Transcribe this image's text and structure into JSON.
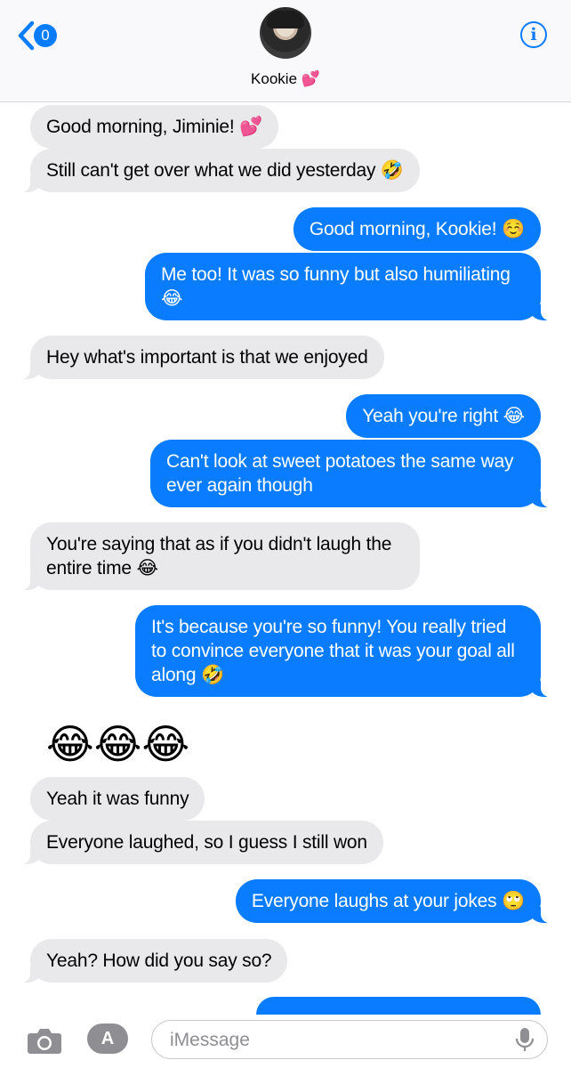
{
  "header": {
    "back_count": "0",
    "contact_name": "Kookie",
    "name_emoji": "💕",
    "info_label": "i"
  },
  "messages": [
    {
      "dir": "in",
      "text": "Good morning, Jiminie! 💕"
    },
    {
      "dir": "in",
      "text": "Still can't get over what we did yesterday 🤣"
    },
    {
      "dir": "out",
      "text": "Good morning, Kookie! ☺️"
    },
    {
      "dir": "out",
      "text": "Me too! It was so funny but also humiliating 😂"
    },
    {
      "dir": "in",
      "text": "Hey what's important is that we enjoyed"
    },
    {
      "dir": "out",
      "text": "Yeah you're right 😂"
    },
    {
      "dir": "out",
      "text": "Can't look at sweet potatoes the same way ever again though"
    },
    {
      "dir": "in",
      "text": "You're saying that as if you didn't laugh the entire time 😂"
    },
    {
      "dir": "out",
      "text": "It's because you're so funny! You really tried to convince everyone that it was your goal all along 🤣"
    },
    {
      "dir": "in",
      "text": "😂😂😂"
    },
    {
      "dir": "in",
      "text": "Yeah it was funny"
    },
    {
      "dir": "in",
      "text": "Everyone laughed, so I guess I still won"
    },
    {
      "dir": "out",
      "text": "Everyone laughs at your jokes 🙄"
    },
    {
      "dir": "in",
      "text": "Yeah? How did you say so?"
    }
  ],
  "compose": {
    "placeholder": "iMessage",
    "appstore_icon": "A"
  },
  "icons": {
    "back": "chevron-left-icon",
    "info": "info-icon",
    "camera": "camera-icon",
    "appstore": "app-store-icon",
    "mic": "microphone-icon"
  },
  "colors": {
    "accent": "#0a7cff",
    "incoming_bubble": "#e9e9eb"
  }
}
